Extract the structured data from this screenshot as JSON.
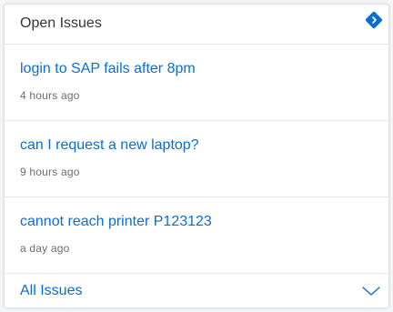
{
  "header": {
    "title": "Open Issues",
    "icon": "diamond-navigation-icon",
    "accent_color": "#0a6ed1"
  },
  "issues": [
    {
      "title": "login to SAP fails after 8pm",
      "time": "4 hours ago"
    },
    {
      "title": "can I request a new laptop?",
      "time": "9 hours ago"
    },
    {
      "title": "cannot reach printer P123123",
      "time": "a day ago"
    }
  ],
  "footer": {
    "label": "All Issues",
    "icon": "chevron-down-icon"
  }
}
